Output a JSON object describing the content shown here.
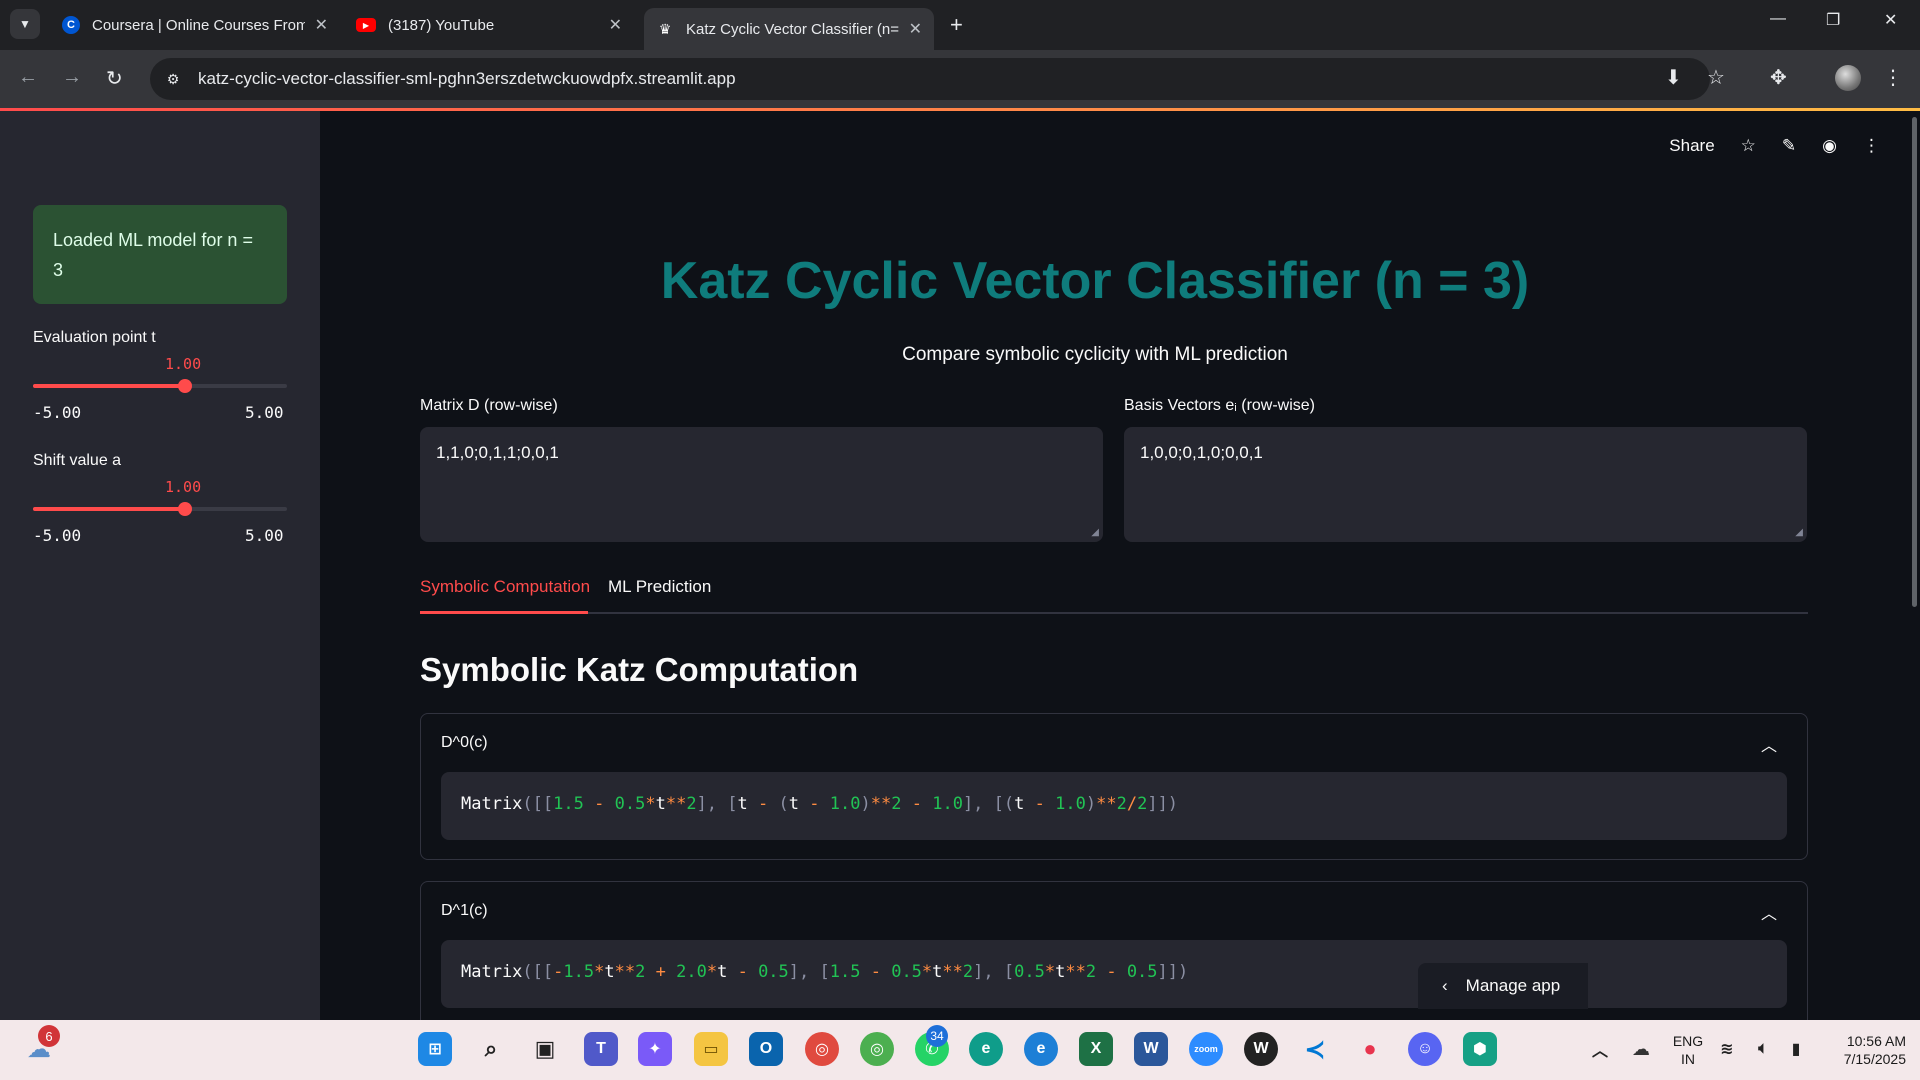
{
  "browser": {
    "tabs": [
      {
        "title": "Coursera | Online Courses From",
        "favicon": "C"
      },
      {
        "title": "(3187) YouTube",
        "favicon": "yt"
      },
      {
        "title": "Katz Cyclic Vector Classifier (n=",
        "favicon": "crown"
      }
    ],
    "url": "katz-cyclic-vector-classifier-sml-pghn3erszdetwckuowdpfx.streamlit.app"
  },
  "sidebar": {
    "model_message": "Loaded ML model for n = 3",
    "sliders": [
      {
        "label": "Evaluation point t",
        "value": "1.00",
        "min": "-5.00",
        "max": "5.00",
        "fraction": 0.6
      },
      {
        "label": "Shift value a",
        "value": "1.00",
        "min": "-5.00",
        "max": "5.00",
        "fraction": 0.6
      }
    ]
  },
  "header": {
    "share_label": "Share"
  },
  "main": {
    "title": "Katz Cyclic Vector Classifier (n = 3)",
    "subtitle": "Compare symbolic cyclicity with ML prediction",
    "matrix_label": "Matrix D (row-wise)",
    "matrix_value": "1,1,0;0,1,1;0,0,1",
    "basis_label": "Basis Vectors eᵢ (row-wise)",
    "basis_value": "1,0,0;0,1,0;0,0,1",
    "tabs": [
      "Symbolic Computation",
      "ML Prediction"
    ],
    "active_tab": "Symbolic Computation",
    "section_title": "Symbolic Katz Computation",
    "expanders": [
      {
        "title": "D^0(c)",
        "code": "Matrix([[1.5 - 0.5*t**2], [t - (t - 1.0)**2 - 1.0], [(t - 1.0)**2/2]])"
      },
      {
        "title": "D^1(c)",
        "code": "Matrix([[-1.5*t**2 + 2.0*t - 0.5], [1.5 - 0.5*t**2], [0.5*t**2 - 0.5]])"
      }
    ],
    "manage_app": "Manage app"
  },
  "taskbar": {
    "weather_badge": "6",
    "whatsapp_badge": "34",
    "lang_line1": "ENG",
    "lang_line2": "IN",
    "time": "10:56 AM",
    "date": "7/15/2025"
  },
  "colors": {
    "accent": "#ff4b4b",
    "title": "#0f7c7c",
    "success_bg": "#2b5233",
    "sidebar_bg": "#262730",
    "main_bg": "#0e1117"
  }
}
